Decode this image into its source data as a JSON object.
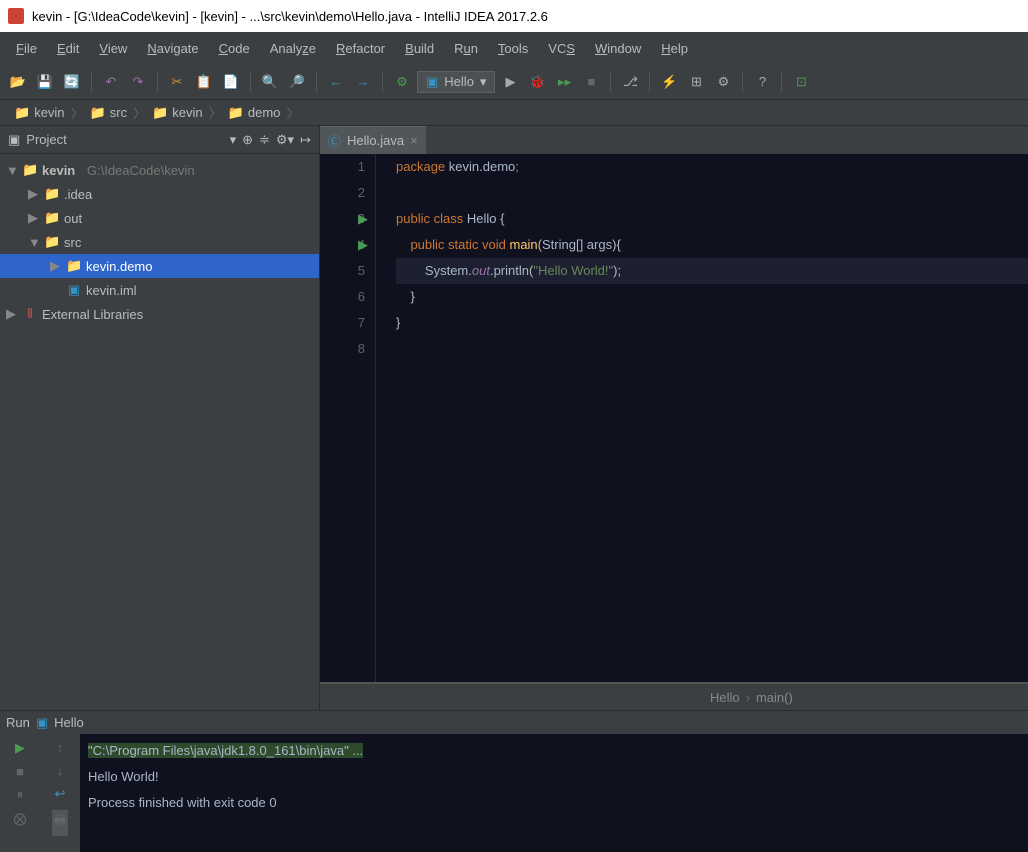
{
  "title": "kevin - [G:\\IdeaCode\\kevin] - [kevin] - ...\\src\\kevin\\demo\\Hello.java - IntelliJ IDEA 2017.2.6",
  "menus": [
    "File",
    "Edit",
    "View",
    "Navigate",
    "Code",
    "Analyze",
    "Refactor",
    "Build",
    "Run",
    "Tools",
    "VCS",
    "Window",
    "Help"
  ],
  "run_config": "Hello",
  "breadcrumbs": [
    {
      "icon": "folder-blue",
      "label": "kevin"
    },
    {
      "icon": "folder-blue",
      "label": "src"
    },
    {
      "icon": "folder-blue",
      "label": "kevin"
    },
    {
      "icon": "folder-blue",
      "label": "demo"
    }
  ],
  "sidebar_title": "Project",
  "tree": {
    "root": {
      "label": "kevin",
      "path": "G:\\IdeaCode\\kevin"
    },
    "idea": ".idea",
    "out": "out",
    "src": "src",
    "pkg": "kevin.demo",
    "iml": "kevin.iml",
    "ext": "External Libraries"
  },
  "tab": "Hello.java",
  "code_lines": [
    {
      "n": 1,
      "html": "<span class='kw'>package</span> <span class='pkg'>kevin.demo</span><span class='punct'>;</span>"
    },
    {
      "n": 2,
      "html": ""
    },
    {
      "n": 3,
      "run": true,
      "html": "<span class='kw'>public class</span> <span class='cls'>Hello</span> {"
    },
    {
      "n": 4,
      "run": true,
      "html": "    <span class='kw'>public static</span> <span class='typ'>void</span> <span class='id'>main</span>(<span class='param'>String[] args</span>){"
    },
    {
      "n": 5,
      "cur": true,
      "html": "        <span class='sys'>System</span>.<span class='out'>out</span>.<span class='sys'>println</span>(<span class='str'>\"Hello World!\"</span>);"
    },
    {
      "n": 6,
      "html": "    }"
    },
    {
      "n": 7,
      "html": "}"
    },
    {
      "n": 8,
      "html": ""
    }
  ],
  "editor_breadcrumb": {
    "a": "Hello",
    "b": "main()"
  },
  "run_header": {
    "a": "Run",
    "b": "Hello"
  },
  "output": {
    "cmd": "\"C:\\Program Files\\java\\jdk1.8.0_161\\bin\\java\" ...",
    "l1": "Hello World!",
    "l2": "",
    "l3": "Process finished with exit code 0"
  }
}
